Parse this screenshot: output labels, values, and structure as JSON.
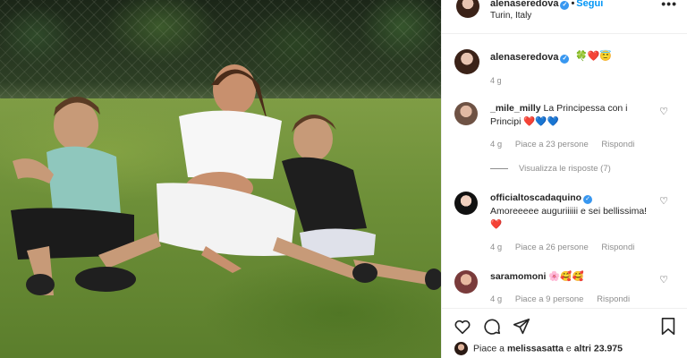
{
  "post": {
    "username": "alenaseredova",
    "location": "Turin, Italy",
    "follow_label": "Segui",
    "more_label": "•••",
    "caption_emojis": "🍀❤️😇",
    "caption_time": "4 g"
  },
  "comments": [
    {
      "username": "_mile_milly",
      "text": "La Principessa con i Principi",
      "emoji": "❤️💙💙",
      "time": "4 g",
      "likes": "Piace a 23 persone",
      "reply": "Rispondi"
    },
    {
      "username": "officialtoscadaquino",
      "text": "Amoreeeee auguriiiiii e sei bellissima!",
      "emoji": "❤️",
      "time": "4 g",
      "likes": "Piace a 26 persone",
      "reply": "Rispondi"
    },
    {
      "username": "saramomoni",
      "text": "",
      "emoji": "🌸🥰🥰",
      "time": "4 g",
      "likes": "Piace a 9 persone",
      "reply": "Rispondi"
    }
  ],
  "view_replies": "Visualizza le risposte (7)",
  "likes_summary": {
    "prefix": "Piace a",
    "user": "melissasatta",
    "conj": "e",
    "others": "altri 23.975"
  },
  "colors": {
    "accent": "#0095f6",
    "verified": "#3897f0",
    "muted": "#8e8e8e"
  },
  "icons": [
    "heart-icon",
    "comment-icon",
    "share-icon",
    "bookmark-icon",
    "more-icon",
    "verified-icon"
  ]
}
